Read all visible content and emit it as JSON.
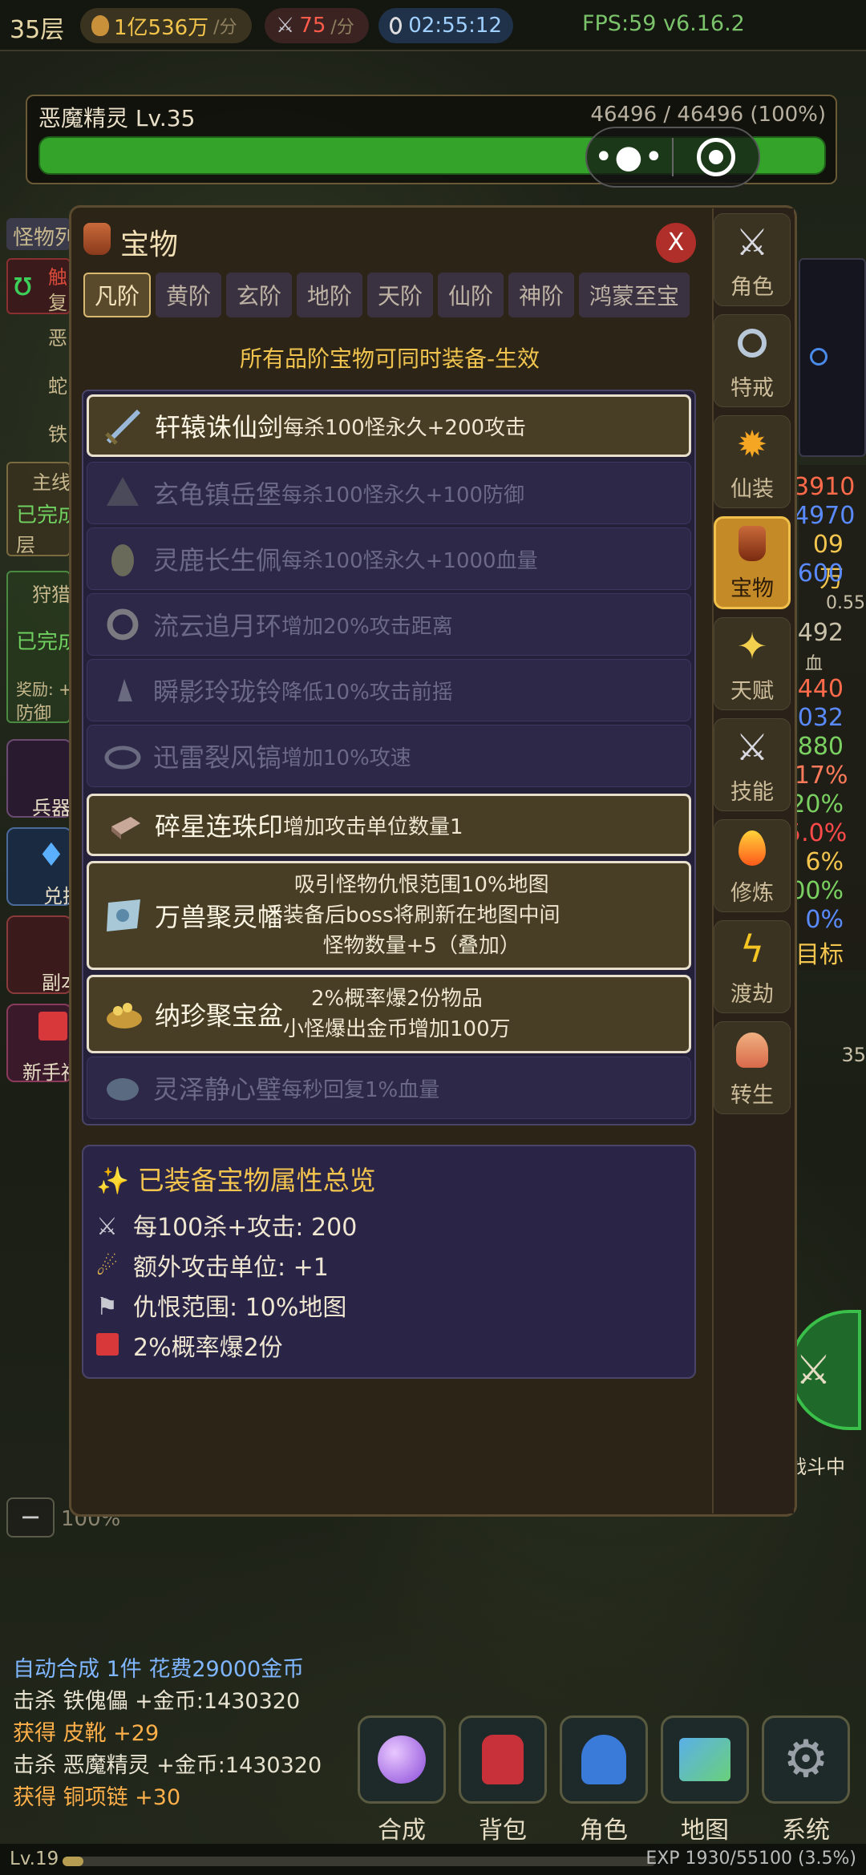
{
  "topbar": {
    "floor": "35层",
    "gold_rate": "1亿536万",
    "gold_unit": "/分",
    "kill_rate": "75",
    "kill_unit": "/分",
    "timer": "02:55:12",
    "fps": "FPS:59 v6.16.2"
  },
  "boss": {
    "name": "恶魔精灵 Lv.35",
    "hp": "46496 / 46496 (100%)",
    "hp_fraction": 1.0
  },
  "background": {
    "monster_label": "怪物列",
    "side_texts": [
      "触",
      "复",
      "恶",
      "蛇",
      "铁"
    ],
    "task1": [
      "主线",
      "已完成",
      "层"
    ],
    "task2": [
      "狩猎",
      "已完成",
      "奖励: +",
      "防御"
    ],
    "stubs": [
      "兵器",
      "兑换",
      "副本",
      "新手福"
    ],
    "right_stats": [
      "3910",
      "4970",
      "09万",
      "600",
      "492",
      "血",
      "440",
      "032",
      "880",
      "-17%",
      "20%",
      "5.0%",
      "6%",
      "00%",
      "0%",
      "目标"
    ],
    "right_small": [
      "0.55",
      "35"
    ],
    "fight_label": "战斗中",
    "zoom": "100%",
    "zoom_minus": "−"
  },
  "panel": {
    "title": "宝物",
    "close": "X",
    "tabs": [
      "凡阶",
      "黄阶",
      "玄阶",
      "地阶",
      "天阶",
      "仙阶",
      "神阶",
      "鸿蒙至宝"
    ],
    "active_tab": 0,
    "subtitle": "所有品阶宝物可同时装备-生效",
    "items": [
      {
        "name": "轩辕诛仙剑",
        "desc": "每杀100怪永久+200攻击",
        "equipped": true,
        "icon": "sword-icon"
      },
      {
        "name": "玄龟镇岳堡",
        "desc": "每杀100怪永久+100防御",
        "equipped": false,
        "icon": "fortress-icon"
      },
      {
        "name": "灵鹿长生佩",
        "desc": "每杀100怪永久+1000血量",
        "equipped": false,
        "icon": "pendant-icon"
      },
      {
        "name": "流云追月环",
        "desc": "增加20%攻击距离",
        "equipped": false,
        "icon": "ring-icon"
      },
      {
        "name": "瞬影玲珑铃",
        "desc": "降低10%攻击前摇",
        "equipped": false,
        "icon": "bell-icon"
      },
      {
        "name": "迅雷裂风镐",
        "desc": "增加10%攻速",
        "equipped": false,
        "icon": "bangle-icon"
      },
      {
        "name": "碎星连珠印",
        "desc": "增加攻击单位数量1",
        "equipped": true,
        "icon": "seal-icon"
      },
      {
        "name": "万兽聚灵幡",
        "lines": [
          "吸引怪物仇恨范围10%地图",
          "装备后boss将刷新在地图中间",
          "怪物数量+5（叠加）"
        ],
        "equipped": true,
        "icon": "banner-icon"
      },
      {
        "name": "纳珍聚宝盆",
        "lines": [
          "2%概率爆2份物品",
          "小怪爆出金币增加100万"
        ],
        "equipped": true,
        "icon": "treasure-bowl-icon"
      },
      {
        "name": "灵泽静心璧",
        "desc": "每秒回复1%血量",
        "equipped": false,
        "icon": "jade-disc-icon"
      }
    ],
    "summary": {
      "title": "已装备宝物属性总览",
      "rows": [
        "每100杀+攻击: 200",
        "额外攻击单位: +1",
        "仇恨范围: 10%地图",
        "2%概率爆2份"
      ]
    }
  },
  "side_nav": [
    "角色",
    "特戒",
    "仙装",
    "宝物",
    "天赋",
    "技能",
    "修炼",
    "渡劫",
    "转生"
  ],
  "side_nav_active": 3,
  "log": [
    {
      "text": "自动合成 1件 花费29000金币",
      "color": "#7fb6ff"
    },
    {
      "text": "击杀 铁傀儡 +金币:1430320",
      "color": "#e8e2d0"
    },
    {
      "text": "获得 皮靴 +29",
      "color": "#ffb04a"
    },
    {
      "text": "击杀 恶魔精灵 +金币:1430320",
      "color": "#e8e2d0"
    },
    {
      "text": "获得 铜项链 +30",
      "color": "#ffb04a"
    }
  ],
  "bottom_nav": [
    "合成",
    "背包",
    "角色",
    "地图",
    "系统"
  ],
  "footer": {
    "level": "Lv.19",
    "exp": "EXP 1930/55100 (3.5%)",
    "exp_fraction": 0.035
  }
}
